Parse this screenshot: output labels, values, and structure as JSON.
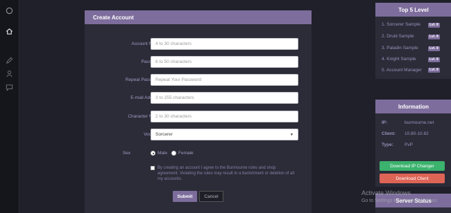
{
  "sidebar": {
    "icons": [
      "circle-icon",
      "home-icon",
      "pencil-icon",
      "user-icon",
      "chat-icon"
    ]
  },
  "form": {
    "title": "Create Account",
    "fields": [
      {
        "label": "Account Name",
        "placeholder": "4 to 30 characters"
      },
      {
        "label": "Password",
        "placeholder": "6 to 50 characters"
      },
      {
        "label": "Repeat Password",
        "placeholder": "Repeat Your Password"
      },
      {
        "label": "E-mail Address",
        "placeholder": "3 to 255 characters"
      },
      {
        "label": "Character Name",
        "placeholder": "2 to 30 characters"
      }
    ],
    "vocation": {
      "label": "Vocation",
      "value": "Sorcerer"
    },
    "sex": {
      "label": "Sex",
      "male": "Male",
      "female": "Female"
    },
    "agreement": "By creating an account I agree to the Burmourne rules and shop agreement. Violating the rules may result in a banishment or deletion of all my accounts.",
    "submit": "Submit",
    "cancel": "Cancel"
  },
  "top5": {
    "title": "Top 5 Level",
    "items": [
      {
        "rank": "1.",
        "name": "Sorcerer Sample",
        "level": "Lvl. 8"
      },
      {
        "rank": "2.",
        "name": "Druid Sample",
        "level": "Lvl. 8"
      },
      {
        "rank": "3.",
        "name": "Paladin Sample",
        "level": "Lvl. 8"
      },
      {
        "rank": "4.",
        "name": "Knight Sample",
        "level": "Lvl. 8"
      },
      {
        "rank": "5.",
        "name": "Account Manager",
        "level": "Lvl. 8"
      }
    ]
  },
  "information": {
    "title": "Information",
    "rows": [
      {
        "key": "IP:",
        "value": "burmourne.net"
      },
      {
        "key": "Client:",
        "value": "10.80-10.82"
      },
      {
        "key": "Type:",
        "value": "PvP"
      }
    ],
    "ip_changer": "Download IP Changer",
    "client": "Download Client"
  },
  "server_status": {
    "title": "Server Status"
  },
  "watermark": {
    "line1": "Activate Windows",
    "line2": "Go to Settings to activate Windows."
  },
  "colors": {
    "accent": "#7d6d9c",
    "green": "#3bb26d",
    "red": "#de6456",
    "background": "#1f2029"
  }
}
